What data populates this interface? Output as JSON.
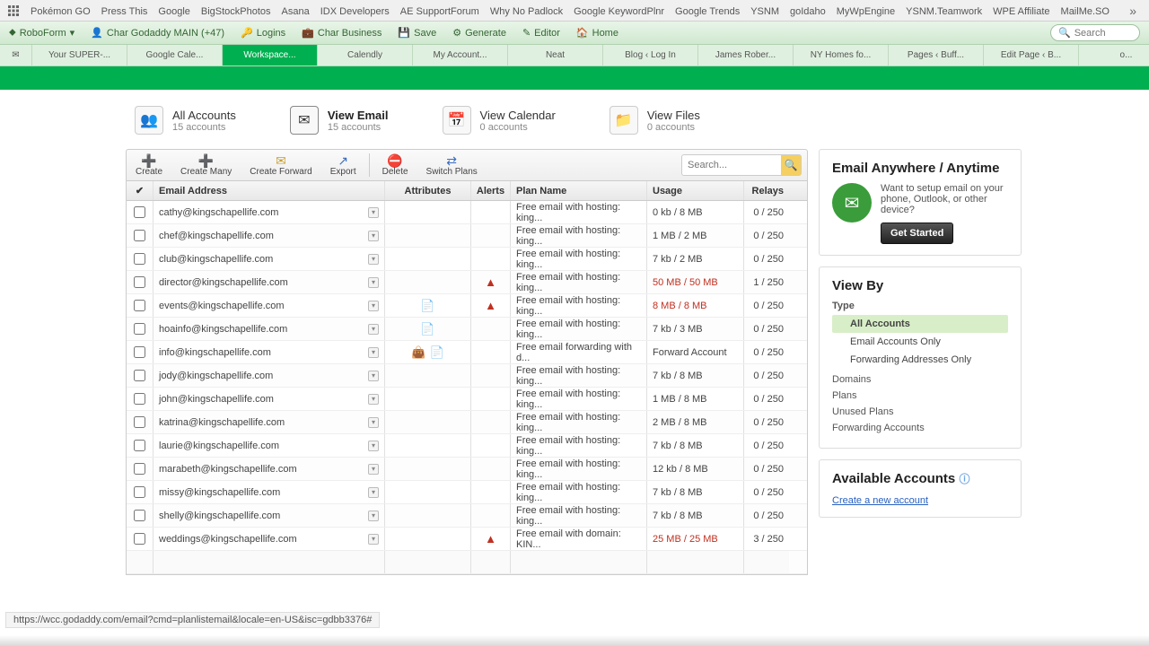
{
  "bookmarks": [
    "Pokémon GO",
    "Press This",
    "Google",
    "BigStockPhotos",
    "Asana",
    "IDX Developers",
    "AE SupportForum",
    "Why No Padlock",
    "Google KeywordPlnr",
    "Google Trends",
    "YSNM",
    "goIdaho",
    "MyWpEngine",
    "YSNM.Teamwork",
    "WPE Affiliate",
    "MailMe.SO"
  ],
  "toolbar": {
    "brand": "RoboForm",
    "identity": "Char Godaddy MAIN (+47)",
    "logins": "Logins",
    "business": "Char Business",
    "save": "Save",
    "generate": "Generate",
    "editor": "Editor",
    "home": "Home",
    "search_placeholder": "Search"
  },
  "tabs": [
    "Your SUPER-...",
    "Google Cale...",
    "Workspace...",
    "Calendly",
    "My Account...",
    "Neat",
    "Blog ‹ Log In",
    "James Rober...",
    "NY Homes fo...",
    "Pages ‹ Buff...",
    "Edit Page ‹ B...",
    "o..."
  ],
  "tabs_active_index": 2,
  "nav": {
    "all": {
      "title": "All Accounts",
      "sub": "15 accounts"
    },
    "email": {
      "title": "View Email",
      "sub": "15 accounts"
    },
    "cal": {
      "title": "View Calendar",
      "sub": "0 accounts"
    },
    "files": {
      "title": "View Files",
      "sub": "0 accounts"
    }
  },
  "actions": {
    "create": "Create",
    "create_many": "Create Many",
    "create_fwd": "Create Forward",
    "export": "Export",
    "delete": "Delete",
    "switch": "Switch Plans",
    "search_placeholder": "Search..."
  },
  "columns": {
    "email": "Email Address",
    "attr": "Attributes",
    "alerts": "Alerts",
    "plan": "Plan Name",
    "usage": "Usage",
    "relays": "Relays"
  },
  "rows": [
    {
      "email": "cathy@kingschapellife.com",
      "attr": [],
      "alert": false,
      "plan": "Free email with hosting: king...",
      "usage": "0 kb / 8 MB",
      "warn": false,
      "relays": "0 / 250"
    },
    {
      "email": "chef@kingschapellife.com",
      "attr": [],
      "alert": false,
      "plan": "Free email with hosting: king...",
      "usage": "1 MB / 2 MB",
      "warn": false,
      "relays": "0 / 250"
    },
    {
      "email": "club@kingschapellife.com",
      "attr": [],
      "alert": false,
      "plan": "Free email with hosting: king...",
      "usage": "7 kb / 2 MB",
      "warn": false,
      "relays": "0 / 250"
    },
    {
      "email": "director@kingschapellife.com",
      "attr": [],
      "alert": true,
      "plan": "Free email with hosting: king...",
      "usage": "50 MB / 50 MB",
      "warn": true,
      "relays": "1 / 250"
    },
    {
      "email": "events@kingschapellife.com",
      "attr": [
        "page"
      ],
      "alert": true,
      "plan": "Free email with hosting: king...",
      "usage": "8 MB / 8 MB",
      "warn": true,
      "relays": "0 / 250"
    },
    {
      "email": "hoainfo@kingschapellife.com",
      "attr": [
        "page"
      ],
      "alert": false,
      "plan": "Free email with hosting: king...",
      "usage": "7 kb / 3 MB",
      "warn": false,
      "relays": "0 / 250"
    },
    {
      "email": "info@kingschapellife.com",
      "attr": [
        "bag",
        "page"
      ],
      "alert": false,
      "plan": "Free email forwarding with d...",
      "usage": "Forward Account",
      "warn": false,
      "relays": "0 / 250"
    },
    {
      "email": "jody@kingschapellife.com",
      "attr": [],
      "alert": false,
      "plan": "Free email with hosting: king...",
      "usage": "7 kb / 8 MB",
      "warn": false,
      "relays": "0 / 250"
    },
    {
      "email": "john@kingschapellife.com",
      "attr": [],
      "alert": false,
      "plan": "Free email with hosting: king...",
      "usage": "1 MB / 8 MB",
      "warn": false,
      "relays": "0 / 250"
    },
    {
      "email": "katrina@kingschapellife.com",
      "attr": [],
      "alert": false,
      "plan": "Free email with hosting: king...",
      "usage": "2 MB / 8 MB",
      "warn": false,
      "relays": "0 / 250"
    },
    {
      "email": "laurie@kingschapellife.com",
      "attr": [],
      "alert": false,
      "plan": "Free email with hosting: king...",
      "usage": "7 kb / 8 MB",
      "warn": false,
      "relays": "0 / 250"
    },
    {
      "email": "marabeth@kingschapellife.com",
      "attr": [],
      "alert": false,
      "plan": "Free email with hosting: king...",
      "usage": "12 kb / 8 MB",
      "warn": false,
      "relays": "0 / 250"
    },
    {
      "email": "missy@kingschapellife.com",
      "attr": [],
      "alert": false,
      "plan": "Free email with hosting: king...",
      "usage": "7 kb / 8 MB",
      "warn": false,
      "relays": "0 / 250"
    },
    {
      "email": "shelly@kingschapellife.com",
      "attr": [],
      "alert": false,
      "plan": "Free email with hosting: king...",
      "usage": "7 kb / 8 MB",
      "warn": false,
      "relays": "0 / 250"
    },
    {
      "email": "weddings@kingschapellife.com",
      "attr": [],
      "alert": true,
      "plan": "Free email with domain: KIN...",
      "usage": "25 MB / 25 MB",
      "warn": true,
      "relays": "3 / 250"
    }
  ],
  "promo": {
    "title": "Email Anywhere / Anytime",
    "body": "Want to setup email on your phone, Outlook, or other device?",
    "cta": "Get Started"
  },
  "viewby": {
    "title": "View By",
    "type_label": "Type",
    "items": [
      "All Accounts",
      "Email Accounts Only",
      "Forwarding Addresses Only"
    ],
    "active_index": 0,
    "extra": [
      "Domains",
      "Plans",
      "Unused Plans",
      "Forwarding Accounts"
    ]
  },
  "avail": {
    "title": "Available Accounts",
    "link": "Create a new account"
  },
  "status_url": "https://wcc.godaddy.com/email?cmd=planlistemail&locale=en-US&isc=gdbb3376#"
}
